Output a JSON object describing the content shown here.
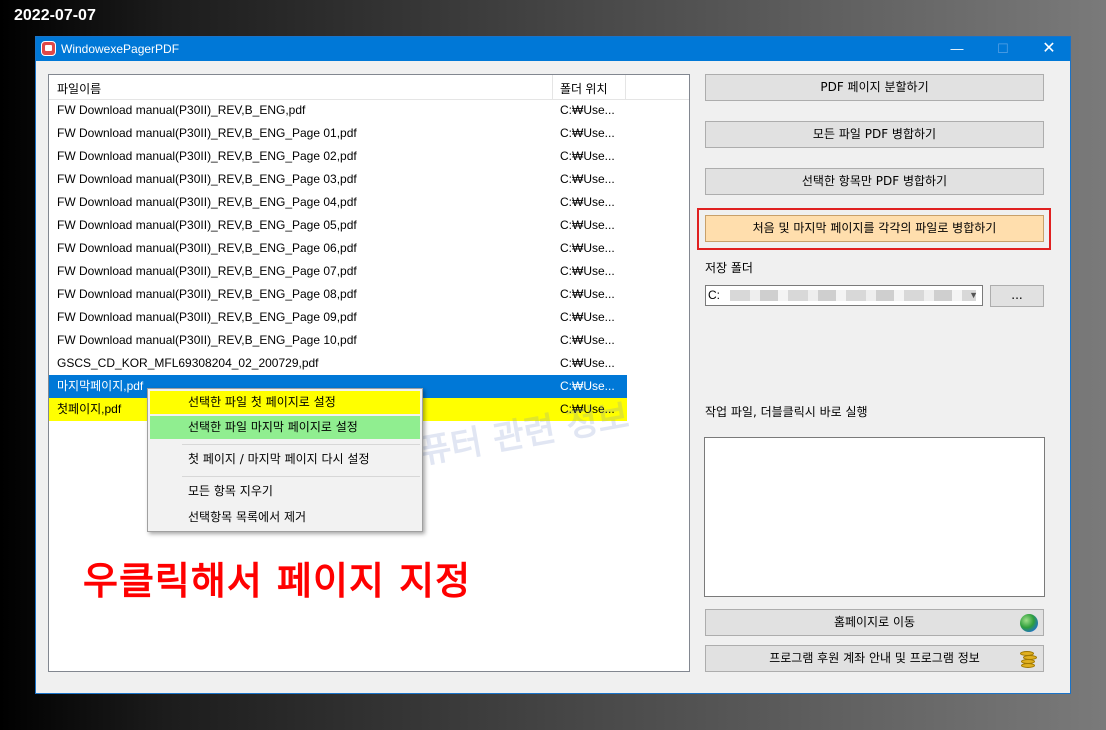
{
  "date_stamp": "2022-07-07",
  "window": {
    "title": "WindowexePagerPDF",
    "controls": {
      "minimize": "—",
      "maximize": "☐",
      "close": "✕"
    }
  },
  "file_list": {
    "columns": {
      "name": "파일이름",
      "folder": "폴더 위치"
    },
    "rows": [
      {
        "name": "FW Download manual(P30II)_REV,B_ENG,pdf",
        "folder": "C:₩Use..."
      },
      {
        "name": "FW Download manual(P30II)_REV,B_ENG_Page 01,pdf",
        "folder": "C:₩Use..."
      },
      {
        "name": "FW Download manual(P30II)_REV,B_ENG_Page 02,pdf",
        "folder": "C:₩Use..."
      },
      {
        "name": "FW Download manual(P30II)_REV,B_ENG_Page 03,pdf",
        "folder": "C:₩Use..."
      },
      {
        "name": "FW Download manual(P30II)_REV,B_ENG_Page 04,pdf",
        "folder": "C:₩Use..."
      },
      {
        "name": "FW Download manual(P30II)_REV,B_ENG_Page 05,pdf",
        "folder": "C:₩Use..."
      },
      {
        "name": "FW Download manual(P30II)_REV,B_ENG_Page 06,pdf",
        "folder": "C:₩Use..."
      },
      {
        "name": "FW Download manual(P30II)_REV,B_ENG_Page 07,pdf",
        "folder": "C:₩Use..."
      },
      {
        "name": "FW Download manual(P30II)_REV,B_ENG_Page 08,pdf",
        "folder": "C:₩Use..."
      },
      {
        "name": "FW Download manual(P30II)_REV,B_ENG_Page 09,pdf",
        "folder": "C:₩Use..."
      },
      {
        "name": "FW Download manual(P30II)_REV,B_ENG_Page 10,pdf",
        "folder": "C:₩Use..."
      },
      {
        "name": "GSCS_CD_KOR_MFL69308204_02_200729,pdf",
        "folder": "C:₩Use..."
      },
      {
        "name": "마지막페이지,pdf",
        "folder": "C:₩Use...",
        "state": "selected"
      },
      {
        "name": "첫페이지,pdf",
        "folder": "C:₩Use...",
        "state": "first"
      }
    ]
  },
  "context_menu": {
    "set_first": "선택한 파일 첫 페이지로 설정",
    "set_last": "선택한 파일 마지막 페이지로 설정",
    "reset": "첫 페이지 / 마지막 페이지 다시 설정",
    "clear_all": "모든 항목 지우기",
    "remove_selected": "선택항목 목록에서 제거"
  },
  "annotation": {
    "caption": "우클릭해서 페이지 지정",
    "watermark": "컴퓨터 관련 정보"
  },
  "buttons": {
    "split": "PDF 페이지 분할하기",
    "merge_all": "모든 파일 PDF 병합하기",
    "merge_selected": "선택한 항목만 PDF 병합하기",
    "merge_first_last": "처음 및 마지막 페이지를 각각의 파일로 병합하기",
    "browse": "...",
    "homepage": "홈페이지로 이동",
    "donate": "프로그램 후원 계좌 안내 및 프로그램 정보"
  },
  "save_folder": {
    "label": "저장 폴더",
    "value": "C:"
  },
  "work_files": {
    "label": "작업 파일, 더블클릭시 바로 실행"
  },
  "colors": {
    "titlebar": "#0078d7",
    "selected_row": "#0078d7",
    "first_page_highlight": "#ffff00",
    "last_page_highlight": "#90ee90",
    "emphasis_button": "#ffdead",
    "annotation_red": "#ff0000"
  },
  "icons": {
    "globe": "globe-icon",
    "coins": "coins-icon",
    "app": "app-icon"
  }
}
